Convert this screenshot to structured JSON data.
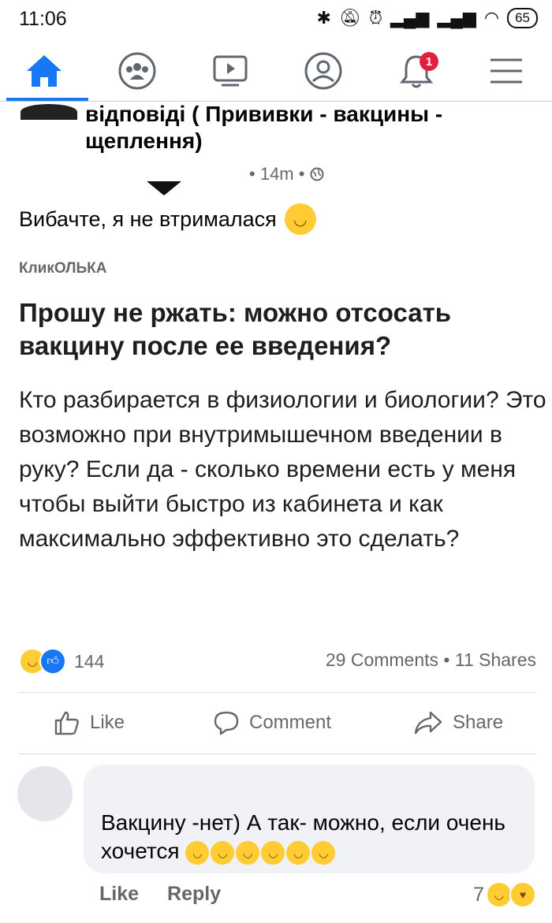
{
  "status_bar": {
    "time": "11:06",
    "icons": [
      "bluetooth-icon",
      "mute-icon",
      "alarm-icon",
      "signal-icon",
      "signal-icon",
      "wifi-icon"
    ],
    "battery": "65"
  },
  "nav": {
    "tabs": [
      "home-icon",
      "groups-icon",
      "watch-icon",
      "profile-icon",
      "notifications-icon",
      "menu-icon"
    ],
    "notifications_badge": "1",
    "accent": "#1877f2"
  },
  "post": {
    "group_title": "відповіді ( Прививки - вакцины - щеплення)",
    "time": "14m",
    "text": "Вибачте, я не втрималася",
    "emoji": "sweat-smile-icon"
  },
  "shared": {
    "source": "КликОЛЬКА",
    "headline": "Прошу не ржать: можно отсосать вакцину после ее введения?",
    "body": "Кто разбирается в физиологии и биологии? Это возможно при внутримышечном введении в руку? Если да - сколько времени есть у меня чтобы выйти быстро из кабинета и как максимально эффективно это сделать?"
  },
  "stats": {
    "reactions": "144",
    "comments_shares": "29 Comments • 11 Shares"
  },
  "actions": {
    "like": "Like",
    "comment": "Comment",
    "share": "Share"
  },
  "comment": {
    "text": "Вакцину -нет) А так- можно, если очень хочется",
    "like": "Like",
    "reply": "Reply",
    "reactions_count": "7"
  }
}
